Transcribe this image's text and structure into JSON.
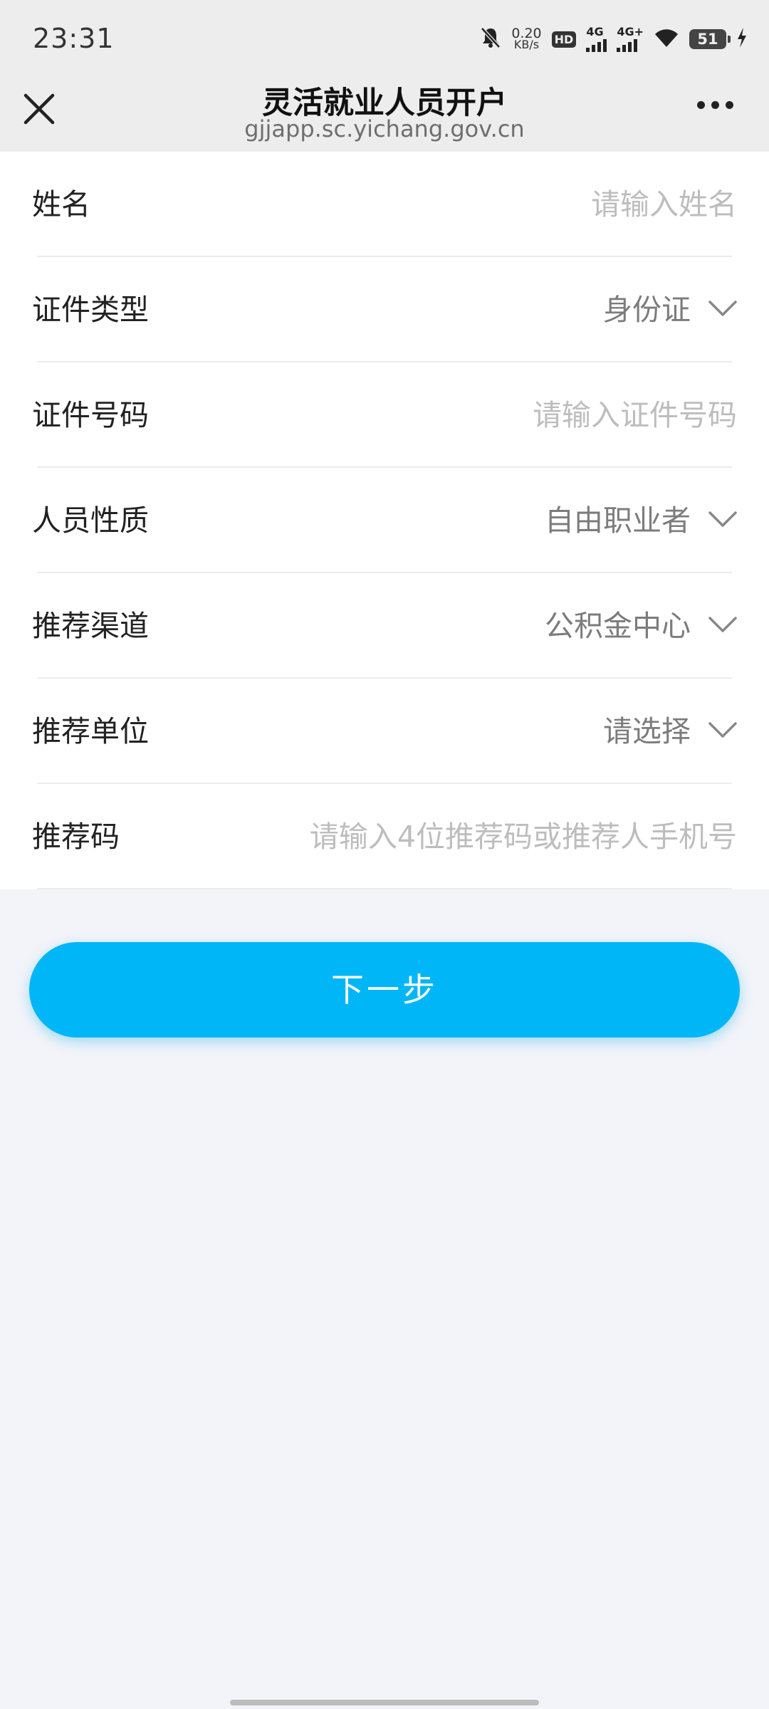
{
  "status_bar": {
    "time": "23:31",
    "net_speed_value": "0.20",
    "net_speed_unit": "KB/s",
    "hd_label": "HD",
    "signal1_label": "4G",
    "signal2_label": "4G+",
    "battery": "51"
  },
  "nav": {
    "title": "灵活就业人员开户",
    "url": "gjjapp.sc.yichang.gov.cn"
  },
  "form": {
    "name": {
      "label": "姓名",
      "placeholder": "请输入姓名"
    },
    "id_type": {
      "label": "证件类型",
      "value": "身份证"
    },
    "id_number": {
      "label": "证件号码",
      "placeholder": "请输入证件号码"
    },
    "person_type": {
      "label": "人员性质",
      "value": "自由职业者"
    },
    "channel": {
      "label": "推荐渠道",
      "value": "公积金中心"
    },
    "unit": {
      "label": "推荐单位",
      "value": "请选择"
    },
    "ref_code": {
      "label": "推荐码",
      "placeholder": "请输入4位推荐码或推荐人手机号"
    }
  },
  "next_button": "下一步",
  "colors": {
    "accent": "#00b6f6",
    "bar_bg": "#ededed",
    "page_bg": "#f2f4f9"
  }
}
